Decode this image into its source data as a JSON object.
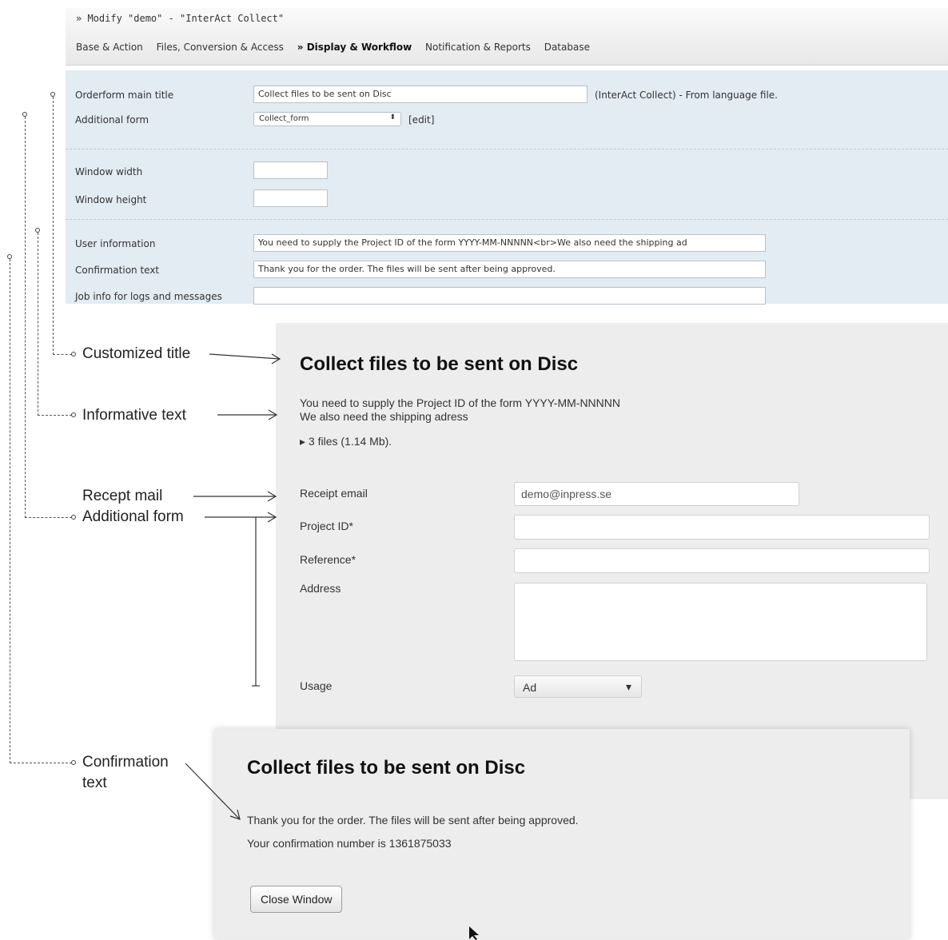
{
  "admin": {
    "breadcrumb": "» Modify \"demo\" - \"InterAct Collect\"",
    "tabs": [
      {
        "label": "Base & Action"
      },
      {
        "label": "Files, Conversion & Access"
      },
      {
        "label": "» Display & Workflow"
      },
      {
        "label": "Notification & Reports"
      },
      {
        "label": "Database"
      }
    ],
    "rows": {
      "main_title": {
        "label": "Orderform main title",
        "value": "Collect files to be sent on Disc",
        "note": "(InterAct Collect) - From language file."
      },
      "additional_form": {
        "label": "Additional form",
        "value": "Collect_form",
        "arrow": "⬍",
        "edit": "[edit]"
      },
      "window_width": {
        "label": "Window width",
        "value": ""
      },
      "window_height": {
        "label": "Window height",
        "value": ""
      },
      "user_information": {
        "label": "User information",
        "value": "You need to supply the Project ID of the form YYYY-MM-NNNNN<br>We also need the shipping ad"
      },
      "confirmation_text": {
        "label": "Confirmation text",
        "value": "Thank you for the order. The files will be sent after being approved."
      },
      "job_info": {
        "label": "Job info for logs and messages",
        "value": ""
      }
    }
  },
  "annotations": {
    "customized_title": "Customized title",
    "informative_text": "Informative text",
    "recept_mail": "Recept mail",
    "additional_form": "Additional form",
    "confirmation_line1": "Confirmation",
    "confirmation_line2": "text"
  },
  "orderform": {
    "title": "Collect files to be sent on Disc",
    "info_line1": "You need to supply the Project ID of the form YYYY-MM-NNNNN",
    "info_line2": "We also need the shipping adress",
    "files_toggle": "▸ 3 files (1.14 Mb).",
    "fields": {
      "receipt_email": {
        "label": "Receipt email",
        "value": "demo@inpress.se"
      },
      "project_id": {
        "label": "Project ID*",
        "value": ""
      },
      "reference": {
        "label": "Reference*",
        "value": ""
      },
      "address": {
        "label": "Address",
        "value": ""
      },
      "usage": {
        "label": "Usage",
        "value": "Ad",
        "arrow": "▾"
      }
    }
  },
  "confirmation": {
    "title": "Collect files to be sent on Disc",
    "message": "Thank you for the order. The files will be sent after being approved.",
    "number_text": "Your confirmation number is 1361875033",
    "close_button": "Close Window"
  }
}
